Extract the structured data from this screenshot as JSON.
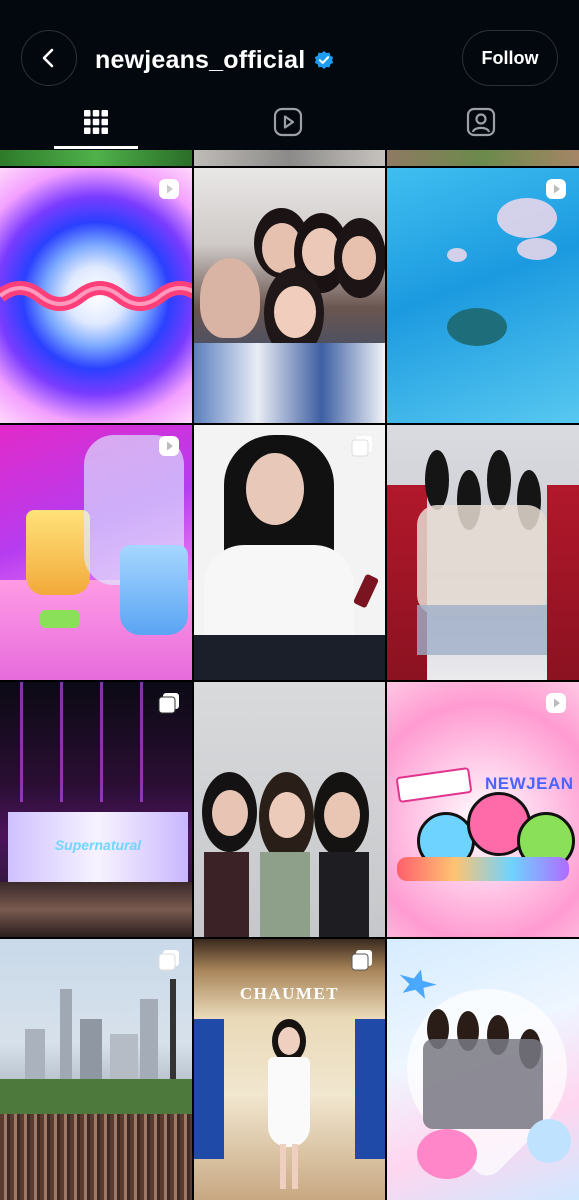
{
  "header": {
    "username": "newjeans_official",
    "follow_label": "Follow"
  },
  "tabs": [
    {
      "name": "grid",
      "icon": "grid-icon",
      "active": true
    },
    {
      "name": "reels",
      "icon": "reels-icon",
      "active": false
    },
    {
      "name": "tagged",
      "icon": "tagged-icon",
      "active": false
    }
  ],
  "colors": {
    "verified": "#1d9bf0",
    "header_bg": "#03080f"
  },
  "posts": {
    "p1_logo": "NEWJEAN",
    "p2_brand": "CHAUMET",
    "p3_logo": "NEWJEAN",
    "p4_screen": "Supernatural"
  }
}
